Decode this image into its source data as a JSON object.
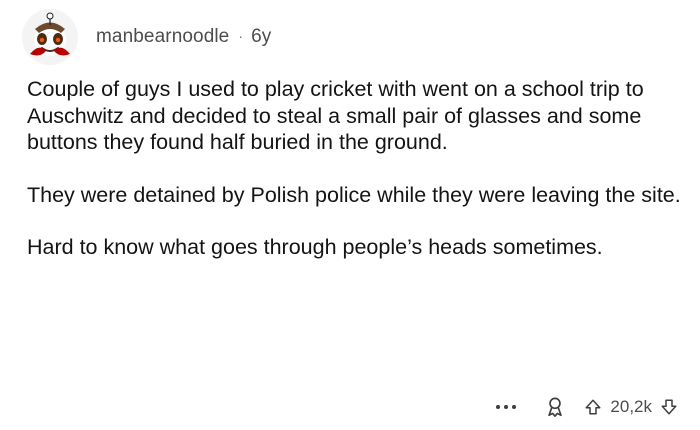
{
  "comment": {
    "author": "manbearnoodle",
    "separator": "·",
    "age": "6y",
    "paragraphs": [
      "Couple of guys I used to play cricket with went on a school trip to Auschwitz and decided to steal a small pair of glasses and some buttons they found half buried in the ground.",
      "They were detained by Polish police while they were leaving the site.",
      "Hard to know what goes through people’s heads sometimes."
    ]
  },
  "actions": {
    "score": "20,2k",
    "more_icon": "more-options-icon",
    "award_icon": "award-icon",
    "upvote_icon": "upvote-arrow-icon",
    "downvote_icon": "downvote-arrow-icon"
  },
  "colors": {
    "text": "#141414",
    "meta": "#4d4d4d",
    "avatar_bg": "#f4f4f4"
  }
}
